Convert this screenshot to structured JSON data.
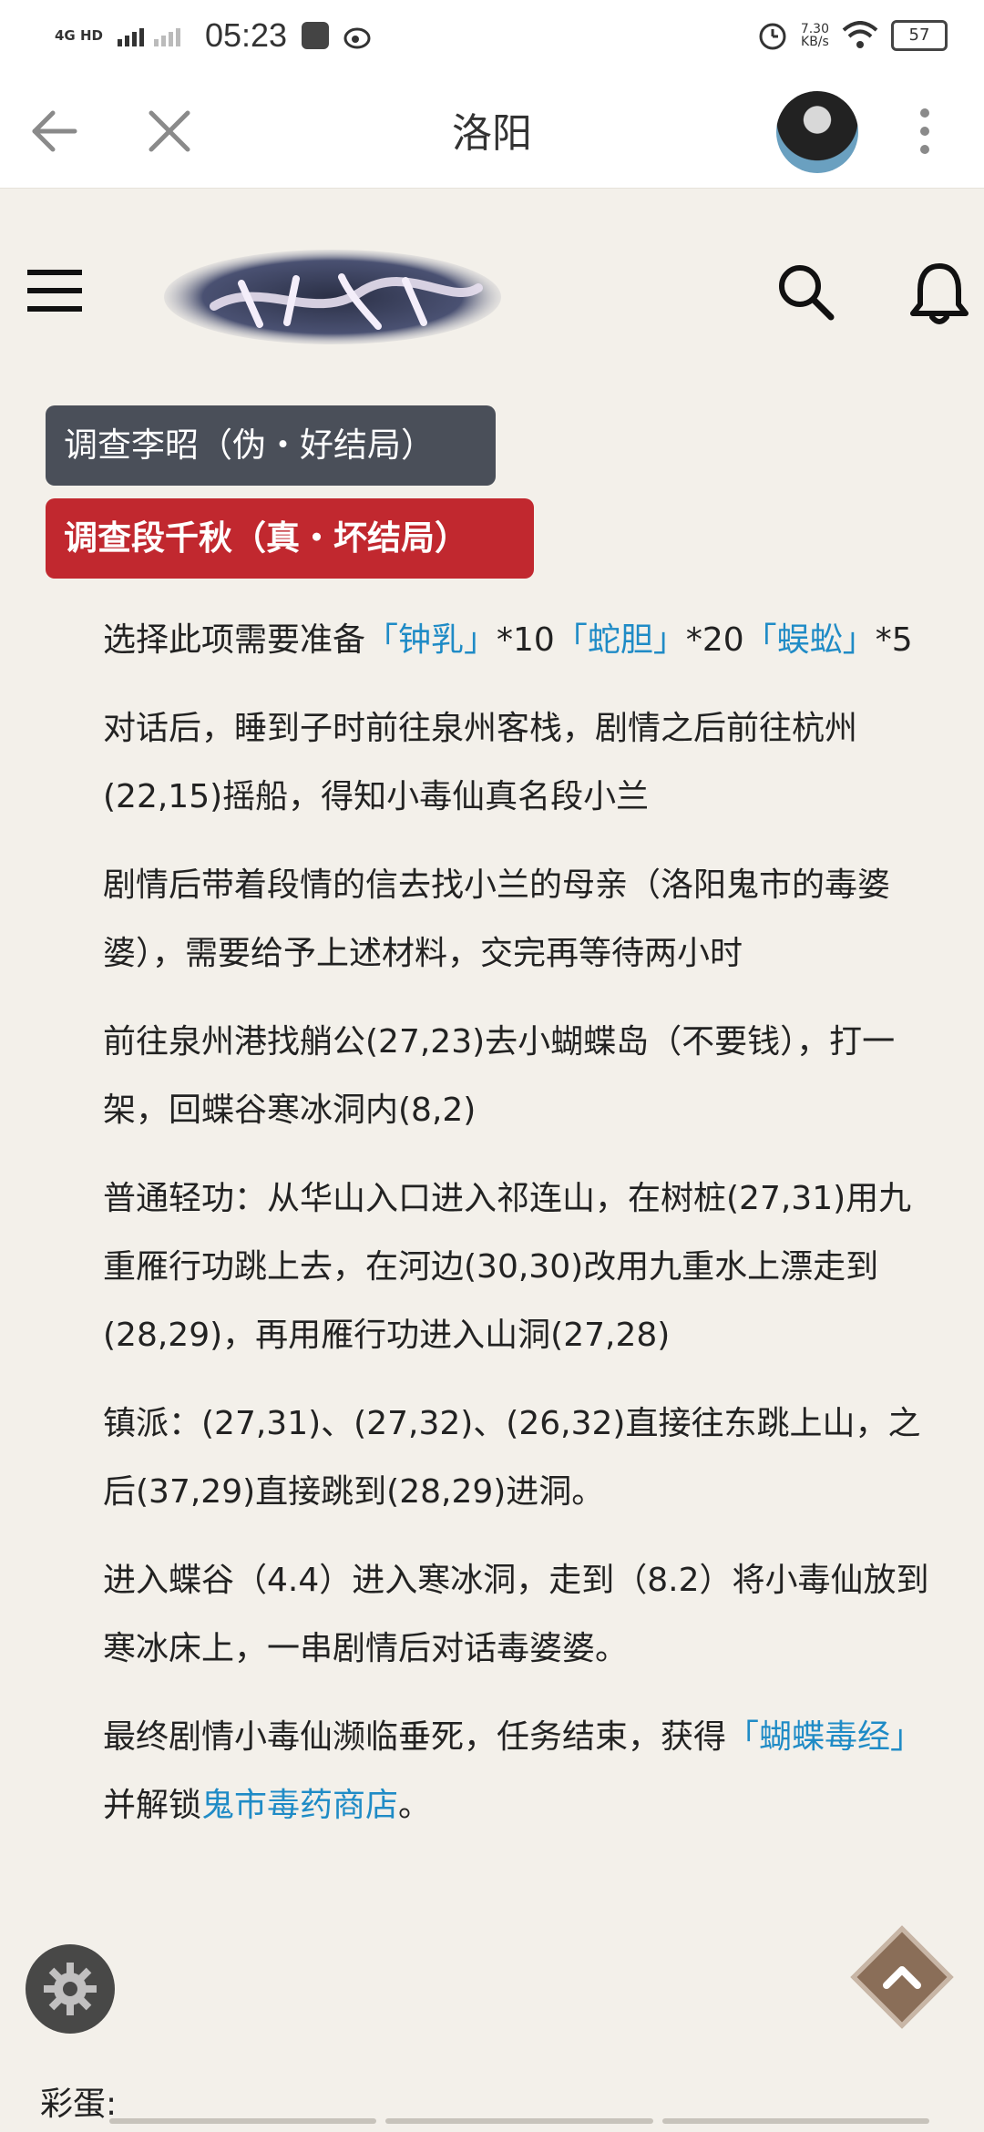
{
  "status_bar": {
    "network": "4G HD",
    "time": "05:23",
    "net_speed_value": "7.30",
    "net_speed_unit": "KB/s",
    "battery": "57"
  },
  "topbar": {
    "title": "洛阳"
  },
  "tags": {
    "grey": "调查李昭（伪・好结局）",
    "red": "调查段千秋（真・坏结局）"
  },
  "article": {
    "p1": {
      "t1": "选择此项需要准备",
      "l1": "「钟乳」",
      "t2": "*10",
      "l2": "「蛇胆」",
      "t3": "*20",
      "l3": "「蜈蚣」",
      "t4": "*5"
    },
    "p2": "对话后，睡到子时前往泉州客栈，剧情之后前往杭州(22,15)摇船，得知小毒仙真名段小兰",
    "p3": "剧情后带着段情的信去找小兰的母亲（洛阳鬼市的毒婆婆），需要给予上述材料，交完再等待两小时",
    "p4": "前往泉州港找艄公(27,23)去小蝴蝶岛（不要钱），打一架，回蝶谷寒冰洞内(8,2)",
    "p5": "普通轻功：从华山入口进入祁连山，在树桩(27,31)用九重雁行功跳上去，在河边(30,30)改用九重水上漂走到(28,29)，再用雁行功进入山洞(27,28)",
    "p6": "镇派：(27,31)、(27,32)、(26,32)直接往东跳上山，之后(37,29)直接跳到(28,29)进洞。",
    "p7": "进入蝶谷（4.4）进入寒冰洞，走到（8.2）将小毒仙放到寒冰床上，一串剧情后对话毒婆婆。",
    "p8": {
      "t1": "最终剧情小毒仙濒临垂死，任务结束，获得",
      "l1": "「蝴蝶毒经」",
      "t2": "并解锁",
      "l2": "鬼市毒药商店",
      "t3": "。"
    }
  },
  "footer_label": "彩蛋:",
  "colors": {
    "link": "#1f8bc6",
    "tag_grey": "#4a4f59",
    "tag_red": "#c1282f"
  },
  "icons": [
    "back-arrow-icon",
    "close-icon",
    "kebab-menu-icon",
    "hamburger-menu-icon",
    "search-icon",
    "bell-icon",
    "gear-icon",
    "back-to-top-icon"
  ]
}
